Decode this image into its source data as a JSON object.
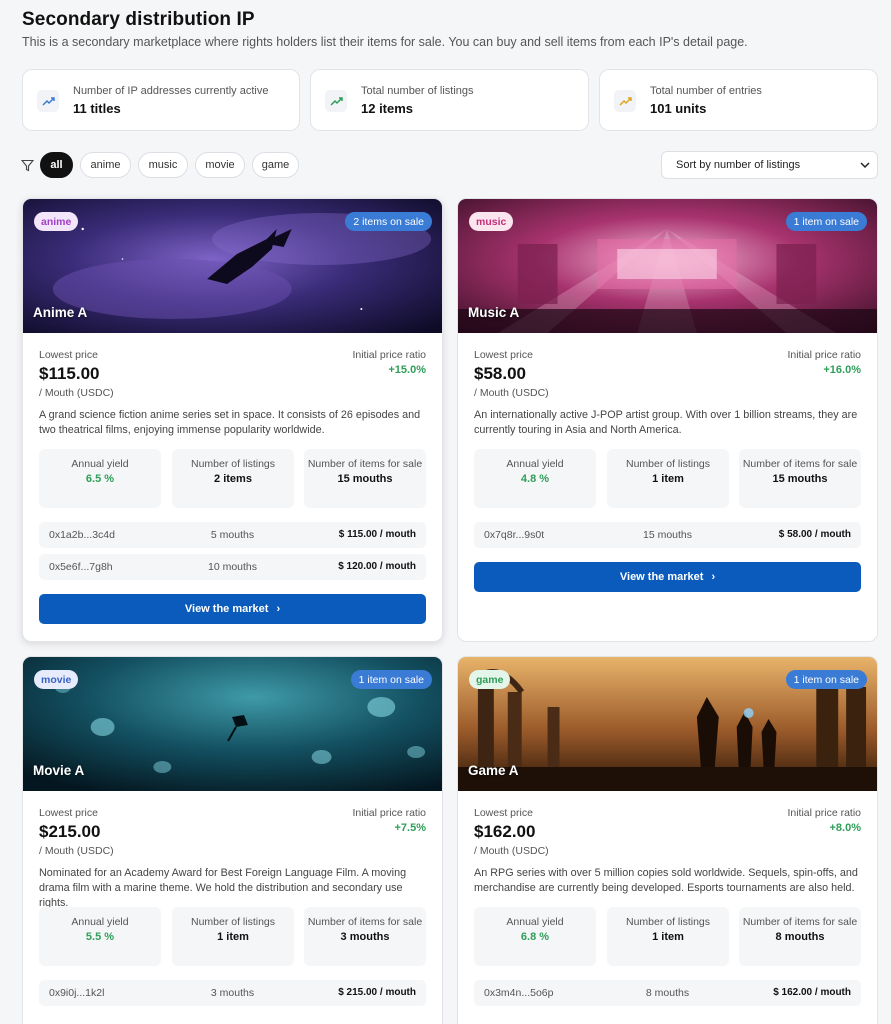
{
  "header": {
    "title": "Secondary distribution IP",
    "description": "This is a secondary marketplace where rights holders list their items for sale. You can buy and sell items from each IP's detail page."
  },
  "stats": [
    {
      "label": "Number of IP addresses currently active",
      "value": "11 titles",
      "icon": "trend-up-icon",
      "color": "#3a7bd5"
    },
    {
      "label": "Total number of listings",
      "value": "12 items",
      "icon": "trend-up-icon",
      "color": "#2f9e58"
    },
    {
      "label": "Total number of entries",
      "value": "101 units",
      "icon": "trend-up-icon",
      "color": "#e0a51a"
    }
  ],
  "filters": [
    "all",
    "anime",
    "movie",
    "music",
    "game"
  ],
  "active_filter": "all",
  "sort": {
    "label": "Sort by number of listings"
  },
  "labels": {
    "lowest_price": "Lowest price",
    "unit": "/ Mouth (USDC)",
    "initial_ratio": "Initial price ratio",
    "annual_yield": "Annual yield",
    "num_listings": "Number of listings",
    "items_for_sale": "Number of items for sale",
    "view_market": "View the market",
    "chevron": "›"
  },
  "cards": [
    {
      "tag": "anime",
      "tag_color": "#a23fc4",
      "sale": "2 items on sale",
      "title": "Anime A",
      "price": "$115.00",
      "ratio": "+15.0%",
      "desc": "A grand science fiction anime series set in space. It consists of 26 episodes and two theatrical films, enjoying immense popularity worldwide.",
      "yield": "6.5 %",
      "listings": "2 items",
      "for_sale": "15 mouths",
      "rows": [
        {
          "addr": "0x1a2b...3c4d",
          "qty": "5 mouths",
          "price": "$ 115.00 / mouth"
        },
        {
          "addr": "0x5e6f...7g8h",
          "qty": "10 mouths",
          "price": "$ 120.00 / mouth"
        }
      ]
    },
    {
      "tag": "music",
      "tag_color": "#c4307a",
      "sale": "1 item on sale",
      "title": "Music A",
      "price": "$58.00",
      "ratio": "+16.0%",
      "desc": "An internationally active J-POP artist group. With over 1 billion streams, they are currently touring in Asia and North America.",
      "yield": "4.8 %",
      "listings": "1 item",
      "for_sale": "15 mouths",
      "rows": [
        {
          "addr": "0x7q8r...9s0t",
          "qty": "15 mouths",
          "price": "$ 58.00 / mouth"
        }
      ]
    },
    {
      "tag": "movie",
      "tag_color": "#3a62c4",
      "sale": "1 item on sale",
      "title": "Movie A",
      "price": "$215.00",
      "ratio": "+7.5%",
      "desc": "Nominated for an Academy Award for Best Foreign Language Film. A moving drama film with a marine theme. We hold the distribution and secondary use rights.",
      "yield": "5.5 %",
      "listings": "1 item",
      "for_sale": "3 mouths",
      "rows": [
        {
          "addr": "0x9i0j...1k2l",
          "qty": "3 mouths",
          "price": "$ 215.00 / mouth"
        }
      ]
    },
    {
      "tag": "game",
      "tag_color": "#2f9e58",
      "sale": "1 item on sale",
      "title": "Game A",
      "price": "$162.00",
      "ratio": "+8.0%",
      "desc": "An RPG series with over 5 million copies sold worldwide. Sequels, spin-offs, and merchandise are currently being developed. Esports tournaments are also held.",
      "yield": "6.8 %",
      "listings": "1 item",
      "for_sale": "8 mouths",
      "rows": [
        {
          "addr": "0x3m4n...5o6p",
          "qty": "8 mouths",
          "price": "$ 162.00 / mouth"
        }
      ]
    }
  ]
}
